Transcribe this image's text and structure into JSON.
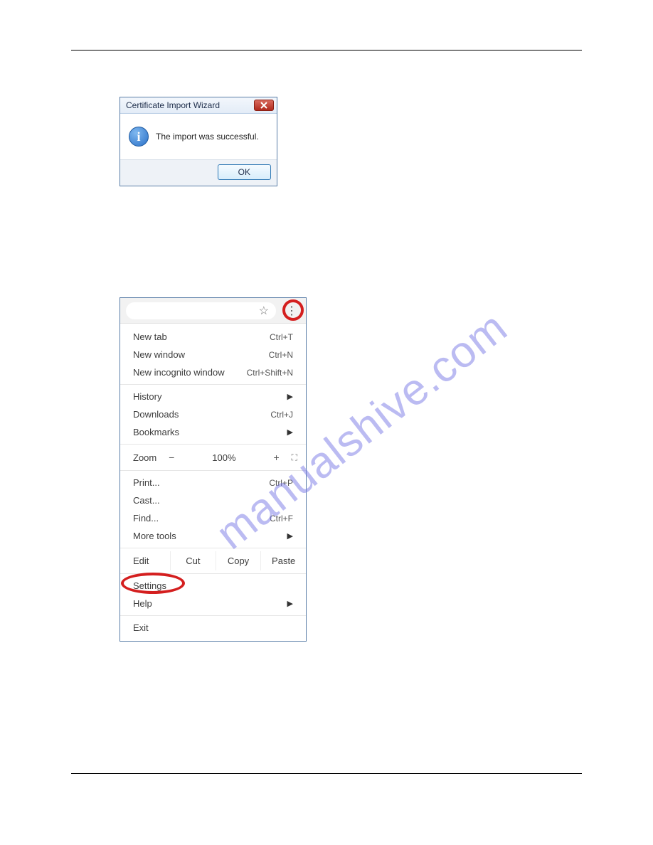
{
  "watermark": "manualshive.com",
  "dialog": {
    "title": "Certificate Import Wizard",
    "message": "The import was successful.",
    "ok_label": "OK"
  },
  "chrome_menu": {
    "zoom": {
      "label": "Zoom",
      "value": "100%"
    },
    "edit": {
      "label": "Edit",
      "cut": "Cut",
      "copy": "Copy",
      "paste": "Paste"
    },
    "items": {
      "new_tab": {
        "label": "New tab",
        "shortcut": "Ctrl+T"
      },
      "new_window": {
        "label": "New window",
        "shortcut": "Ctrl+N"
      },
      "new_incognito": {
        "label": "New incognito window",
        "shortcut": "Ctrl+Shift+N"
      },
      "history": {
        "label": "History"
      },
      "downloads": {
        "label": "Downloads",
        "shortcut": "Ctrl+J"
      },
      "bookmarks": {
        "label": "Bookmarks"
      },
      "print": {
        "label": "Print...",
        "shortcut": "Ctrl+P"
      },
      "cast": {
        "label": "Cast..."
      },
      "find": {
        "label": "Find...",
        "shortcut": "Ctrl+F"
      },
      "more_tools": {
        "label": "More tools"
      },
      "settings": {
        "label": "Settings"
      },
      "help": {
        "label": "Help"
      },
      "exit": {
        "label": "Exit"
      }
    }
  }
}
